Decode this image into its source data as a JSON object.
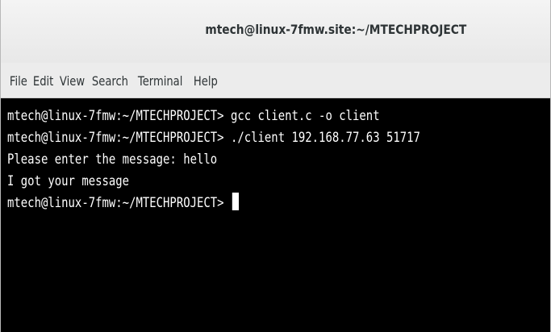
{
  "window": {
    "title": "mtech@linux-7fmw.site:~/MTECHPROJECT"
  },
  "menubar": {
    "items": [
      "File",
      "Edit",
      "View",
      "Search",
      "Terminal",
      "Help"
    ]
  },
  "terminal": {
    "lines": [
      "mtech@linux-7fmw:~/MTECHPROJECT> gcc client.c -o client",
      "mtech@linux-7fmw:~/MTECHPROJECT> ./client 192.168.77.63 51717",
      "Please enter the message: hello",
      "I got your message"
    ],
    "prompt": "mtech@linux-7fmw:~/MTECHPROJECT> "
  },
  "colors": {
    "terminal_bg": "#000000",
    "terminal_fg": "#ffffff",
    "chrome_bg": "#ececec"
  }
}
